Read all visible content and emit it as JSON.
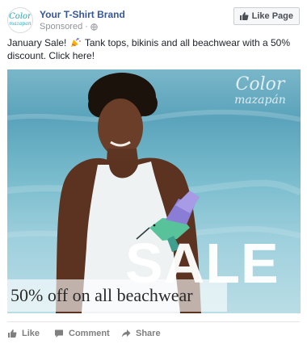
{
  "header": {
    "brand_name": "Your T-Shirt Brand",
    "sponsored_label": "Sponsored",
    "separator": "·",
    "like_page_label": "Like Page"
  },
  "avatar": {
    "logo_line1": "Color",
    "logo_line2": "mazapan"
  },
  "post": {
    "text_before_emoji": "January Sale!",
    "text_after_emoji": "Tank tops, bikinis and all beachwear with a 50% discount. Click here!"
  },
  "image": {
    "watermark_line1": "Color",
    "watermark_line2": "mazapán",
    "sale_word": "SALE",
    "banner_text": "50% off on all beachwear"
  },
  "actions": {
    "like_label": "Like",
    "comment_label": "Comment",
    "share_label": "Share"
  },
  "colors": {
    "brand_link": "#365899",
    "meta_gray": "#90949c",
    "action_gray": "#7f7f7f"
  },
  "icons": {
    "like_page": "thumbs-up-icon",
    "privacy": "globe-icon",
    "emoji": "party-popper-icon",
    "like": "thumbs-up-icon",
    "comment": "speech-bubble-icon",
    "share": "share-arrow-icon"
  }
}
